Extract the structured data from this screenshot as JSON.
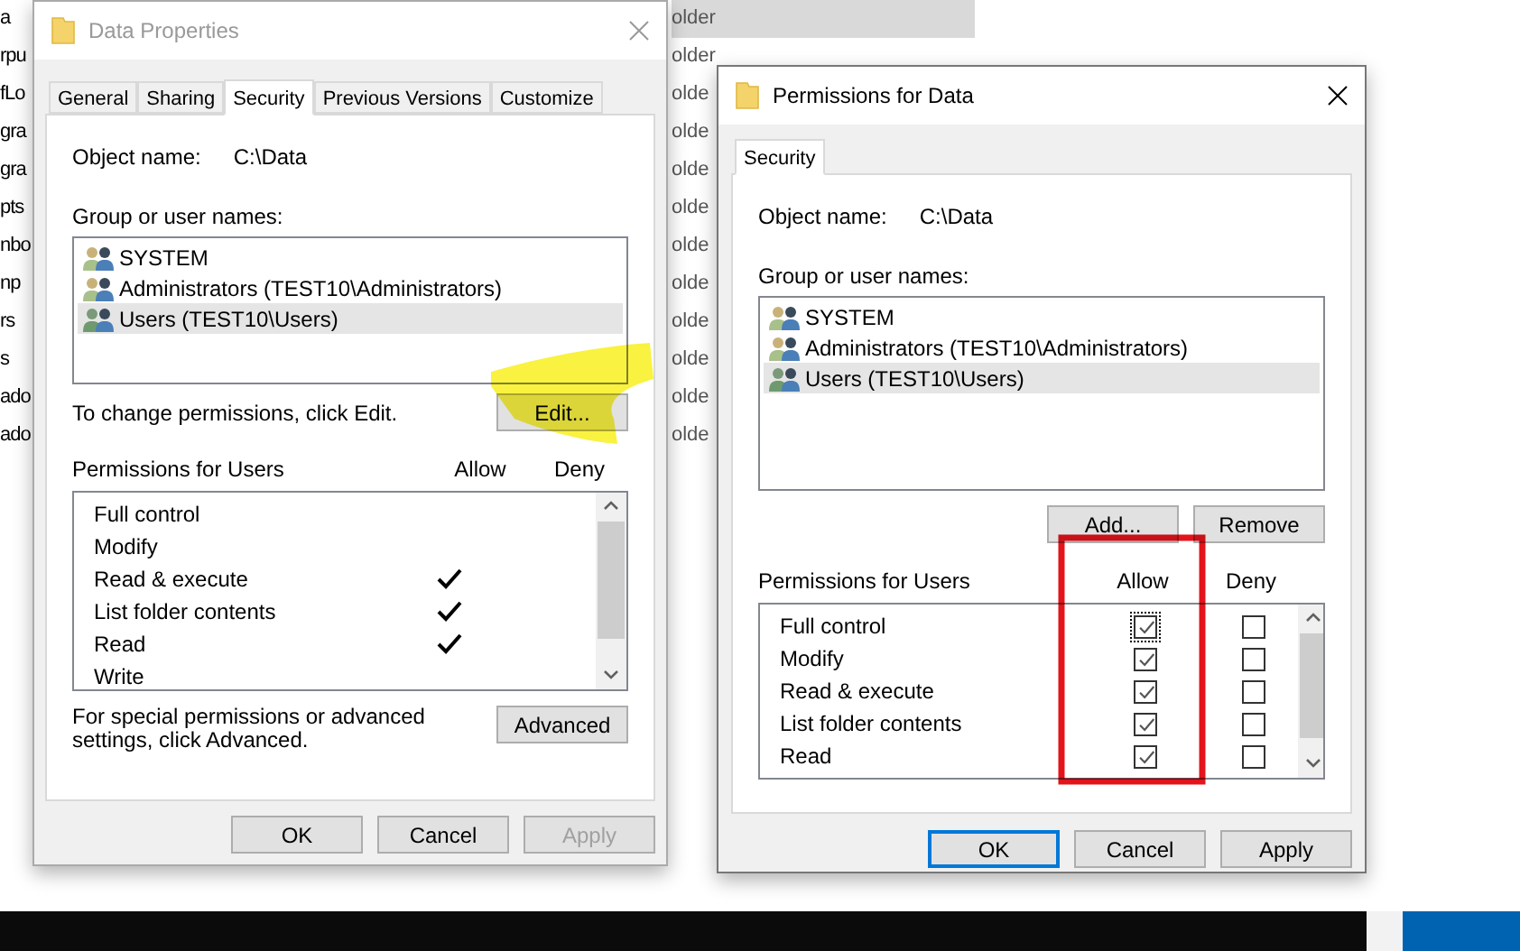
{
  "background": {
    "left_column": [
      "a",
      "rpu",
      "fLo",
      "gra",
      "gra",
      "pts",
      "nbo",
      "np",
      "rs",
      "s",
      "ado",
      "ado"
    ],
    "right_column": [
      {
        "text": "older",
        "selected": true
      },
      {
        "text": "older",
        "selected": false
      },
      {
        "text": "olde",
        "selected": false
      },
      {
        "text": "olde",
        "selected": false
      },
      {
        "text": "olde",
        "selected": false
      },
      {
        "text": "olde",
        "selected": false
      },
      {
        "text": "olde",
        "selected": false
      },
      {
        "text": "olde",
        "selected": false
      },
      {
        "text": "olde",
        "selected": false
      },
      {
        "text": "olde",
        "selected": false
      },
      {
        "text": "olde",
        "selected": false
      },
      {
        "text": "olde",
        "selected": false
      }
    ]
  },
  "properties_dialog": {
    "title": "Data Properties",
    "active": false,
    "tabs": [
      {
        "label": "General",
        "selected": false
      },
      {
        "label": "Sharing",
        "selected": false
      },
      {
        "label": "Security",
        "selected": true
      },
      {
        "label": "Previous Versions",
        "selected": false
      },
      {
        "label": "Customize",
        "selected": false
      }
    ],
    "object_label": "Object name:",
    "object_name": "C:\\Data",
    "groups_label": "Group or user names:",
    "groups": [
      {
        "name": "SYSTEM",
        "selected": false
      },
      {
        "name": "Administrators (TEST10\\Administrators)",
        "selected": false
      },
      {
        "name": "Users (TEST10\\Users)",
        "selected": true
      }
    ],
    "change_hint": "To change permissions, click Edit.",
    "edit_button": "Edit...",
    "permissions_label": "Permissions for Users",
    "allow_header": "Allow",
    "deny_header": "Deny",
    "permissions": [
      {
        "name": "Full control",
        "allow": false,
        "deny": false
      },
      {
        "name": "Modify",
        "allow": false,
        "deny": false
      },
      {
        "name": "Read & execute",
        "allow": true,
        "deny": false
      },
      {
        "name": "List folder contents",
        "allow": true,
        "deny": false
      },
      {
        "name": "Read",
        "allow": true,
        "deny": false
      },
      {
        "name": "Write",
        "allow": false,
        "deny": false
      }
    ],
    "advanced_hint": "For special permissions or advanced settings, click Advanced.",
    "advanced_button": "Advanced",
    "buttons": [
      {
        "label": "OK",
        "disabled": false,
        "default": false
      },
      {
        "label": "Cancel",
        "disabled": false,
        "default": false
      },
      {
        "label": "Apply",
        "disabled": true,
        "default": false
      }
    ]
  },
  "permissions_dialog": {
    "title": "Permissions for Data",
    "active": true,
    "tabs": [
      {
        "label": "Security",
        "selected": true
      }
    ],
    "object_label": "Object name:",
    "object_name": "C:\\Data",
    "groups_label": "Group or user names:",
    "groups": [
      {
        "name": "SYSTEM",
        "selected": false
      },
      {
        "name": "Administrators (TEST10\\Administrators)",
        "selected": false
      },
      {
        "name": "Users (TEST10\\Users)",
        "selected": true
      }
    ],
    "add_button": "Add...",
    "remove_button": "Remove",
    "permissions_label": "Permissions for Users",
    "allow_header": "Allow",
    "deny_header": "Deny",
    "permissions": [
      {
        "name": "Full control",
        "allow": true,
        "deny": false,
        "focused": true
      },
      {
        "name": "Modify",
        "allow": true,
        "deny": false,
        "focused": false
      },
      {
        "name": "Read & execute",
        "allow": true,
        "deny": false,
        "focused": false
      },
      {
        "name": "List folder contents",
        "allow": true,
        "deny": false,
        "focused": false
      },
      {
        "name": "Read",
        "allow": true,
        "deny": false,
        "focused": false
      }
    ],
    "buttons": [
      {
        "label": "OK",
        "disabled": false,
        "default": true
      },
      {
        "label": "Cancel",
        "disabled": false,
        "default": false
      },
      {
        "label": "Apply",
        "disabled": false,
        "default": false
      }
    ]
  }
}
